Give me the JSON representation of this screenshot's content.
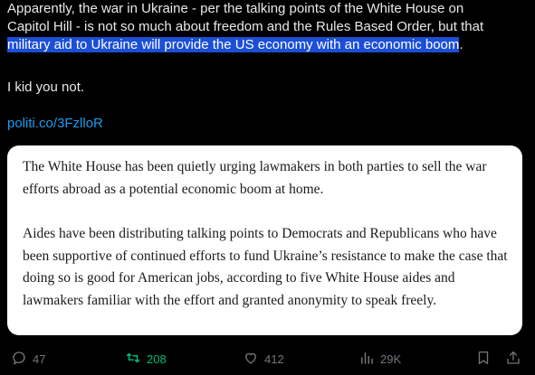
{
  "tweet": {
    "lines": [
      "Apparently, the war in Ukraine - per the talking points of the White House on",
      "Capitol Hill - is not so much about freedom and the Rules Based Order, but that"
    ],
    "highlighted": "military aid to Ukraine will provide the US economy with an economic boom",
    "highlight_suffix": ".",
    "line2": "I kid you not.",
    "link": "politi.co/3FzlloR"
  },
  "card": {
    "p1": "The White House has been quietly urging lawmakers in both parties to sell the war efforts abroad as a potential economic boom at home.",
    "p2": "Aides have been distributing talking points to Democrats and Republicans who have been supportive of continued efforts to fund Ukraine’s resistance to make the case that doing so is good for American jobs, according to five White House aides and lawmakers familiar with the effort and granted anonymity to speak freely."
  },
  "actions": {
    "replies": "47",
    "retweets": "208",
    "likes": "412",
    "views": "29K"
  },
  "colors": {
    "background": "#000000",
    "text": "#e7e9ea",
    "link": "#1d9bf0",
    "highlight": "#1c4fd6",
    "retweet_active": "#00ba7c",
    "muted": "#71767b"
  }
}
